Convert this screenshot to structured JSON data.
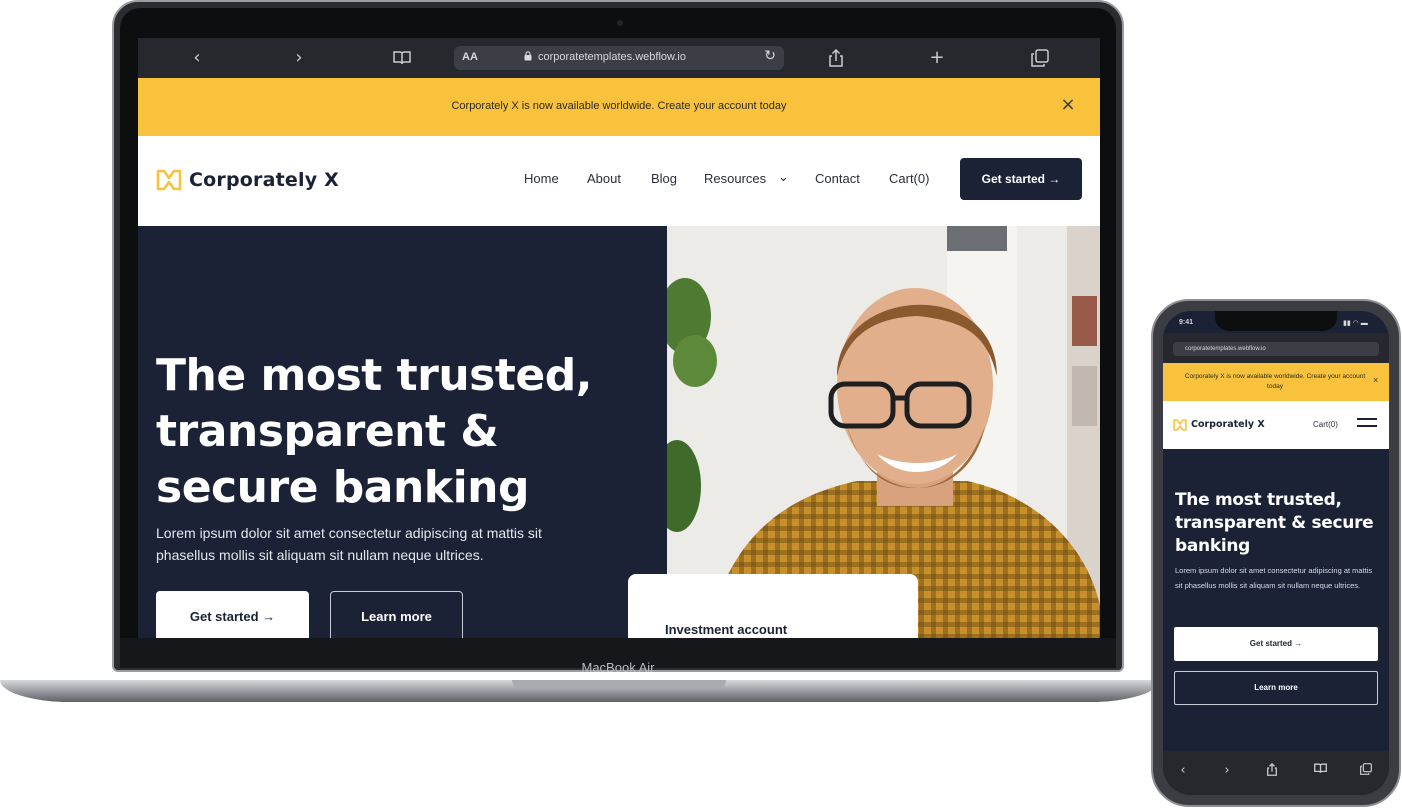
{
  "laptop": {
    "model_label": "MacBook Air",
    "browser": {
      "text_size": "AA",
      "url": "corporatetemplates.webflow.io",
      "back_icon": "‹",
      "forward_icon": "›",
      "reload_icon": "↻",
      "lock_icon": "🔒"
    },
    "announcement": {
      "text": "Corporately X is now available worldwide. Create your account today",
      "close": "×"
    },
    "nav": {
      "brand": "Corporately X",
      "links": [
        "Home",
        "About",
        "Blog",
        "Resources",
        "Contact",
        "Cart(0)"
      ],
      "resources_caret": "⌄",
      "cta": "Get started →"
    },
    "hero": {
      "title": "The most trusted, transparent & secure banking",
      "subtitle": "Lorem ipsum dolor sit amet consectetur adipiscing at mattis sit phasellus mollis sit aliquam sit nullam neque ultrices.",
      "primary_button": "Get started →",
      "secondary_button": "Learn more",
      "card_title": "Investment account"
    }
  },
  "phone": {
    "status_time": "9:41",
    "status_icons": "▮▮ ◠ ▬",
    "url": "corporatetemplates.webflow.io",
    "announcement": {
      "text": "Corporately X is now available worldwide. Create your account today",
      "close": "×"
    },
    "nav": {
      "brand": "Corporately X",
      "cart": "Cart(0)"
    },
    "hero": {
      "title": "The most trusted, transparent & secure banking",
      "subtitle": "Lorem ipsum dolor sit amet consectetur adipiscing at mattis sit phasellus mollis sit aliquam sit nullam neque ultrices.",
      "primary_button": "Get started →",
      "secondary_button": "Learn more"
    }
  },
  "colors": {
    "navy": "#1b2236",
    "yellow": "#f8c23c",
    "white": "#ffffff"
  }
}
